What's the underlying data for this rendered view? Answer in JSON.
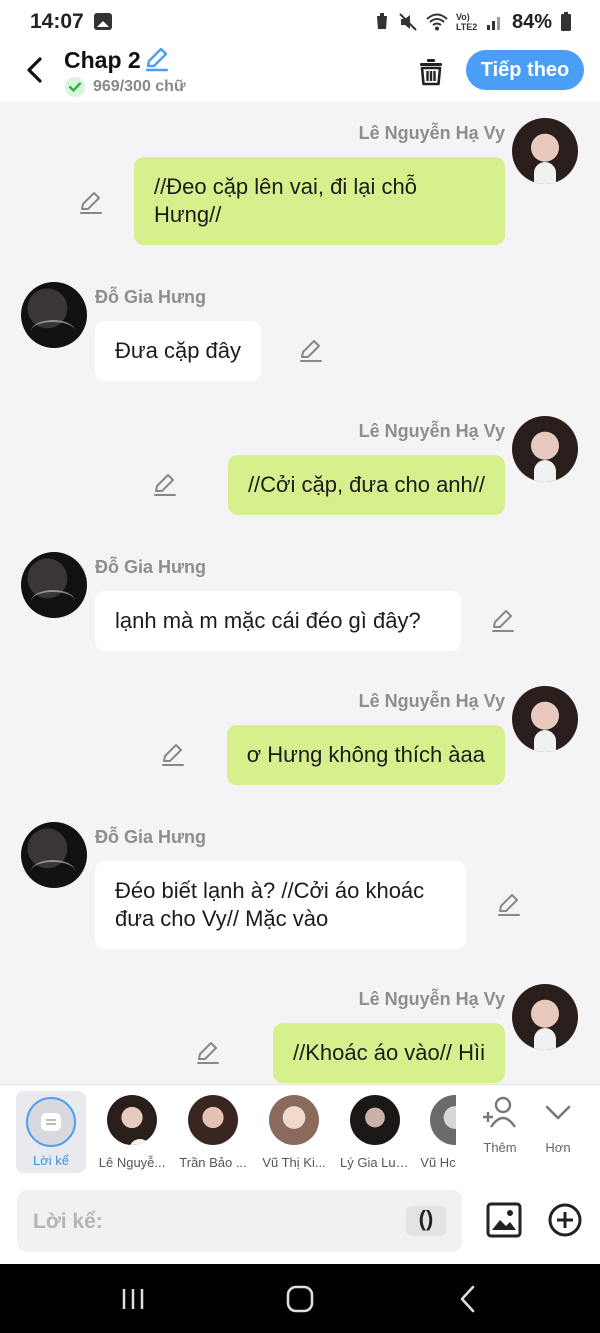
{
  "status_bar": {
    "time": "14:07",
    "battery": "84%",
    "network": "Vo) LTE2"
  },
  "header": {
    "title": "Chap 2",
    "word_count": "969/300 chữ",
    "follow_label": "Tiếp theo"
  },
  "messages": [
    {
      "side": "right",
      "sender": "Lê Nguyễn Hạ Vy",
      "text_line1": "//Đeo cặp lên vai, đi lại chỗ",
      "text_line2": "Hưng//"
    },
    {
      "side": "left",
      "sender": "Đỗ Gia Hưng",
      "text_line1": "Đưa cặp đây"
    },
    {
      "side": "right",
      "sender": "Lê Nguyễn Hạ Vy",
      "text_line1": "//Cởi cặp, đưa cho anh//"
    },
    {
      "side": "left",
      "sender": "Đỗ Gia Hưng",
      "text_line1": "lạnh mà m mặc cái đéo gì đây?"
    },
    {
      "side": "right",
      "sender": "Lê Nguyễn Hạ Vy",
      "text_line1": "ơ Hưng không thích àaa"
    },
    {
      "side": "left",
      "sender": "Đỗ Gia Hưng",
      "text_line1": "Đéo biết lạnh à? //Cởi áo khoác",
      "text_line2": "đưa cho Vy// Mặc vào"
    },
    {
      "side": "right",
      "sender": "Lê Nguyễn Hạ Vy",
      "text_line1": "//Khoác áo vào// Hìi"
    }
  ],
  "character_bar": {
    "narration_label": "Lời kể",
    "characters": [
      {
        "name": "Lê Nguyễ..."
      },
      {
        "name": "Trần Bảo ..."
      },
      {
        "name": "Vũ Thị Ki..."
      },
      {
        "name": "Lý Gia Luân"
      },
      {
        "name": "Vũ Hc"
      }
    ],
    "add_label": "Thêm",
    "more_label": "Hơn"
  },
  "input": {
    "placeholder": "Lời kể:",
    "paren_label": "()"
  },
  "colors": {
    "accent": "#4a9ef5",
    "bubble_right": "#d6f08e",
    "bubble_left": "#ffffff",
    "background": "#f4f4f6"
  }
}
